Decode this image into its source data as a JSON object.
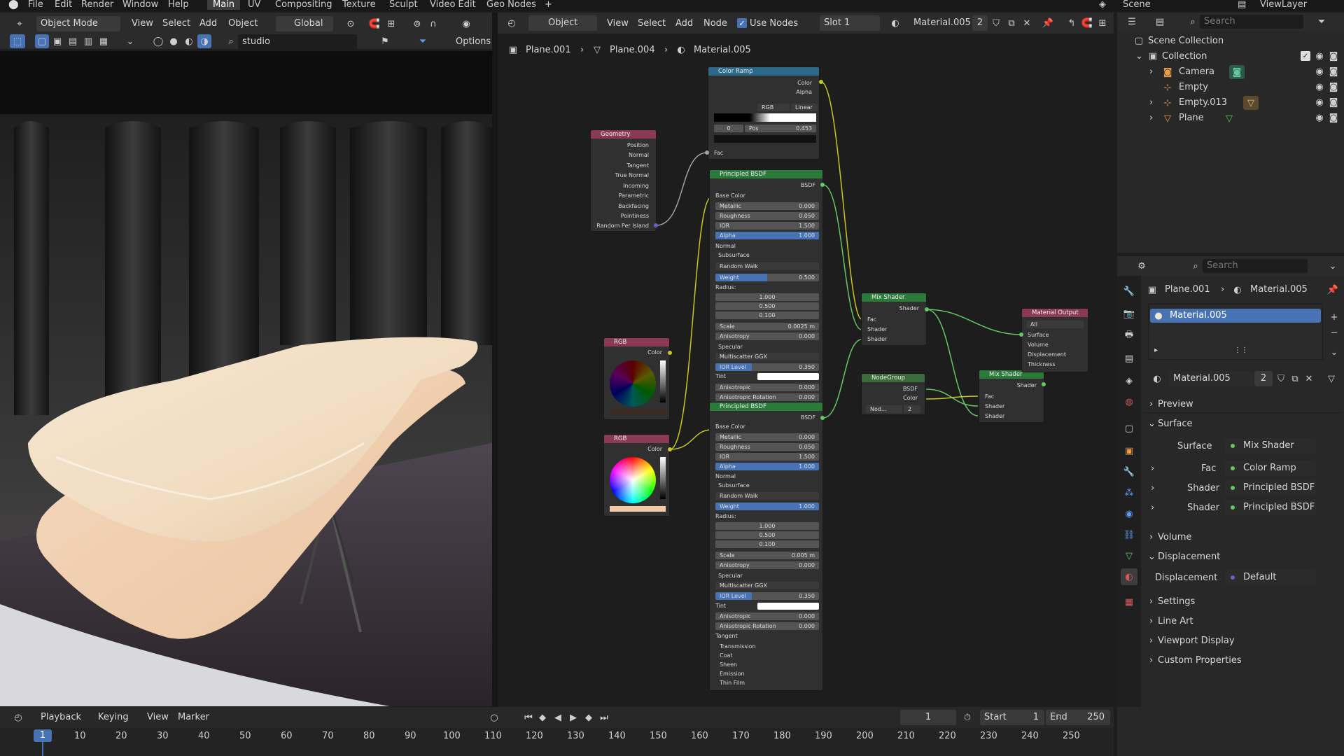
{
  "menu": {
    "items": [
      "File",
      "Edit",
      "Render",
      "Window",
      "Help"
    ],
    "workspaces": [
      "Main",
      "UV",
      "Compositing",
      "Texture",
      "Sculpt",
      "Video Edit",
      "Geo Nodes"
    ],
    "add": "+",
    "scene": "Scene",
    "view_layer": "ViewLayer"
  },
  "viewport": {
    "mode": "Object Mode",
    "menus": [
      "View",
      "Select",
      "Add",
      "Object"
    ],
    "orientation": "Global",
    "hdri": "studio",
    "options": "Options"
  },
  "node_editor": {
    "type": "Object",
    "menus": [
      "View",
      "Select",
      "Add",
      "Node"
    ],
    "use_nodes": "Use Nodes",
    "slot": "Slot 1",
    "material": "Material.005",
    "users": "2",
    "breadcrumb": [
      "Plane.001",
      "Plane.004",
      "Material.005"
    ]
  },
  "nodes": {
    "color_ramp": {
      "title": "Color Ramp",
      "outputs": [
        "Color",
        "Alpha"
      ],
      "color_mode": "RGB",
      "interp": "Linear",
      "index": "0",
      "pos_label": "Pos",
      "pos_value": "0.453",
      "input": "Fac"
    },
    "geometry": {
      "title": "Geometry",
      "outputs": [
        "Position",
        "Normal",
        "Tangent",
        "True Normal",
        "Incoming",
        "Parametric",
        "Backfacing",
        "Pointiness",
        "Random Per Island"
      ]
    },
    "bsdf1": {
      "title": "Principled BSDF",
      "output": "BSDF",
      "rows": [
        [
          "Base Color",
          ""
        ],
        [
          "Metallic",
          "0.000"
        ],
        [
          "Roughness",
          "0.050"
        ],
        [
          "IOR",
          "1.500"
        ],
        [
          "Alpha",
          "1.000"
        ],
        [
          "Normal",
          ""
        ],
        [
          "Subsurface",
          ""
        ],
        [
          "Random Walk",
          ""
        ],
        [
          "Weight",
          "0.500"
        ],
        [
          "Radius:",
          ""
        ],
        [
          "",
          "1.000"
        ],
        [
          "",
          "0.500"
        ],
        [
          "",
          "0.100"
        ],
        [
          "Scale",
          "0.0025 m"
        ],
        [
          "Anisotropy",
          "0.000"
        ],
        [
          "Specular",
          ""
        ],
        [
          "Multiscatter GGX",
          ""
        ],
        [
          "IOR Level",
          "0.350"
        ],
        [
          "Tint",
          ""
        ],
        [
          "Anisotropic",
          "0.000"
        ],
        [
          "Anisotropic Rotation",
          "0.000"
        ]
      ]
    },
    "bsdf2": {
      "title": "Principled BSDF",
      "output": "BSDF",
      "rows": [
        [
          "Base Color",
          ""
        ],
        [
          "Metallic",
          "0.000"
        ],
        [
          "Roughness",
          "0.050"
        ],
        [
          "IOR",
          "1.500"
        ],
        [
          "Alpha",
          "1.000"
        ],
        [
          "Normal",
          ""
        ],
        [
          "Subsurface",
          ""
        ],
        [
          "Random Walk",
          ""
        ],
        [
          "Weight",
          "1.000"
        ],
        [
          "Radius:",
          ""
        ],
        [
          "",
          "1.000"
        ],
        [
          "",
          "0.500"
        ],
        [
          "",
          "0.100"
        ],
        [
          "Scale",
          "0.005 m"
        ],
        [
          "Anisotropy",
          "0.000"
        ],
        [
          "Specular",
          ""
        ],
        [
          "Multiscatter GGX",
          ""
        ],
        [
          "IOR Level",
          "0.350"
        ],
        [
          "Tint",
          ""
        ],
        [
          "Anisotropic",
          "0.000"
        ],
        [
          "Anisotropic Rotation",
          "0.000"
        ],
        [
          "Tangent",
          ""
        ],
        [
          "Transmission",
          ""
        ],
        [
          "Coat",
          ""
        ],
        [
          "Sheen",
          ""
        ],
        [
          "Emission",
          ""
        ],
        [
          "Thin Film",
          ""
        ]
      ]
    },
    "rgb1": {
      "title": "RGB",
      "output": "Color"
    },
    "rgb2": {
      "title": "RGB",
      "output": "Color"
    },
    "mix1": {
      "title": "Mix Shader",
      "output": "Shader",
      "inputs": [
        "Fac",
        "Shader",
        "Shader"
      ]
    },
    "mix2": {
      "title": "Mix Shader",
      "output": "Shader",
      "inputs": [
        "Fac",
        "Shader",
        "Shader"
      ]
    },
    "nodegroup": {
      "title": "NodeGroup",
      "outputs": [
        "BSDF",
        "Color"
      ],
      "name": "Nod...",
      "users": "2"
    },
    "output": {
      "title": "Material Output",
      "target": "All",
      "inputs": [
        "Surface",
        "Volume",
        "Displacement",
        "Thickness"
      ]
    }
  },
  "outliner": {
    "search": "Search",
    "items": [
      {
        "label": "Scene Collection"
      },
      {
        "label": "Collection"
      },
      {
        "label": "Camera"
      },
      {
        "label": "Empty"
      },
      {
        "label": "Empty.013"
      },
      {
        "label": "Plane"
      }
    ]
  },
  "properties": {
    "search": "Search",
    "breadcrumb": [
      "Plane.001",
      "Material.005"
    ],
    "slot": "Material.005",
    "material": "Material.005",
    "users": "2",
    "sections": {
      "preview": "Preview",
      "surface": "Surface",
      "volume": "Volume",
      "displacement": "Displacement",
      "settings": "Settings",
      "line_art": "Line Art",
      "viewport_display": "Viewport Display",
      "custom_properties": "Custom Properties"
    },
    "surface": {
      "surface_label": "Surface",
      "surface_value": "Mix Shader",
      "fac_label": "Fac",
      "fac_value": "Color Ramp",
      "shader1_label": "Shader",
      "shader1_value": "Principled BSDF",
      "shader2_label": "Shader",
      "shader2_value": "Principled BSDF"
    },
    "displacement": {
      "label": "Displacement",
      "value": "Default"
    }
  },
  "timeline": {
    "menus": [
      "Playback",
      "Keying",
      "View",
      "Marker"
    ],
    "current_frame": "1",
    "start_label": "Start",
    "start": "1",
    "end_label": "End",
    "end": "250",
    "ticks": [
      "1",
      "10",
      "20",
      "30",
      "40",
      "50",
      "60",
      "70",
      "80",
      "90",
      "100",
      "110",
      "120",
      "130",
      "140",
      "150",
      "160",
      "170",
      "180",
      "190",
      "200",
      "210",
      "220",
      "230",
      "240",
      "250"
    ]
  },
  "colors": {
    "accent": "#4772b3",
    "bsdf_header": "#2a7a3a",
    "color_header": "#8a3a52",
    "converter_header": "#2d6a8a",
    "group_header": "#3b6a3b",
    "socket_yellow": "#c7c729",
    "socket_grey": "#a1a1a1",
    "socket_green": "#63c763",
    "socket_purple": "#6363c7"
  }
}
